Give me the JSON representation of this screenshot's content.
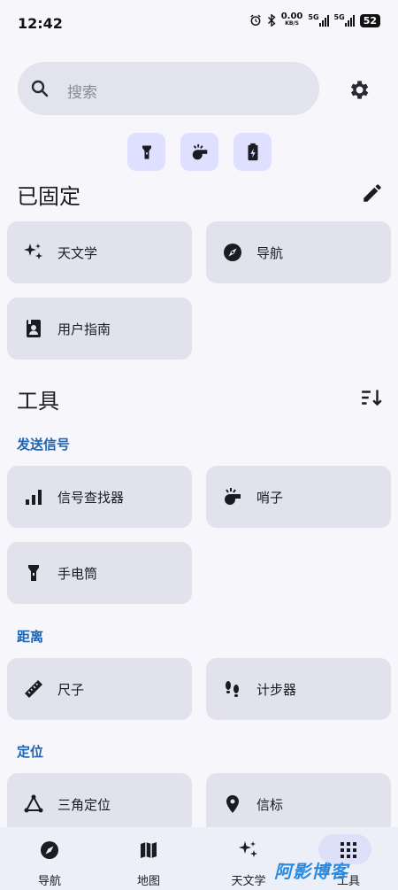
{
  "status_bar": {
    "time": "12:42",
    "net_speed_top": "0.00",
    "net_speed_bottom": "KB/S",
    "net1": "5G",
    "net2": "5G",
    "battery": "52"
  },
  "search": {
    "placeholder": "搜索"
  },
  "pinned": {
    "title": "已固定",
    "items": [
      {
        "label": "天文学",
        "icon": "sparkle-icon"
      },
      {
        "label": "导航",
        "icon": "compass-icon"
      },
      {
        "label": "用户指南",
        "icon": "user-guide-icon"
      }
    ]
  },
  "tools": {
    "title": "工具",
    "groups": [
      {
        "title": "发送信号",
        "items": [
          {
            "label": "信号查找器",
            "icon": "signal-bars-icon"
          },
          {
            "label": "哨子",
            "icon": "whistle-icon"
          },
          {
            "label": "手电筒",
            "icon": "flashlight-icon"
          }
        ]
      },
      {
        "title": "距离",
        "items": [
          {
            "label": "尺子",
            "icon": "ruler-icon"
          },
          {
            "label": "计步器",
            "icon": "footsteps-icon"
          }
        ]
      },
      {
        "title": "定位",
        "items": [
          {
            "label": "三角定位",
            "icon": "triangulation-icon"
          },
          {
            "label": "信标",
            "icon": "location-pin-icon"
          }
        ]
      }
    ]
  },
  "bottom_nav": [
    {
      "label": "导航",
      "icon": "compass-icon"
    },
    {
      "label": "地图",
      "icon": "map-icon"
    },
    {
      "label": "天文学",
      "icon": "sparkle-icon"
    },
    {
      "label": "工具",
      "icon": "grid-icon",
      "selected": true
    }
  ],
  "watermark": "阿影博客",
  "colors": {
    "background": "#f6f6fb",
    "card": "#e1e2ec",
    "accent": "#1e64b4",
    "quick_button": "#dfdfff"
  }
}
